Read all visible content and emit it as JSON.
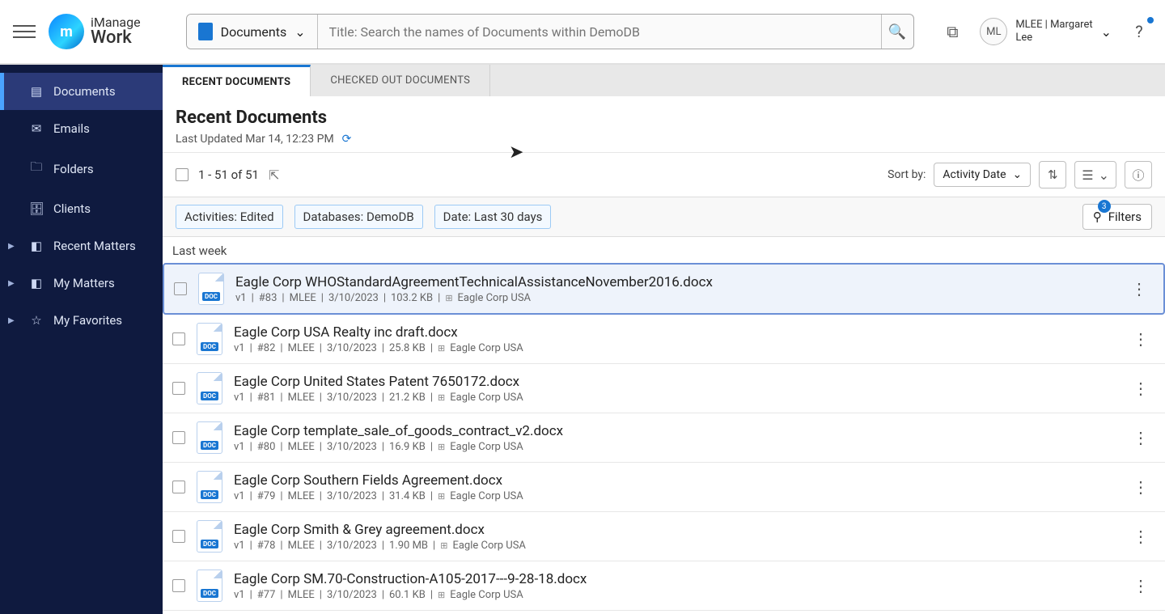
{
  "brand": {
    "l1": "iManage",
    "l2": "Work",
    "mark": "m"
  },
  "search": {
    "scope": "Documents",
    "placeholder": "Title: Search the names of Documents within DemoDB"
  },
  "user": {
    "initials": "ML",
    "line1": "MLEE | Margaret",
    "line2": "Lee"
  },
  "sidebar": [
    {
      "label": "Documents",
      "icon": "▤",
      "active": true,
      "expandable": false
    },
    {
      "label": "Emails",
      "icon": "✉",
      "active": false,
      "expandable": false
    },
    {
      "label": "Folders",
      "icon": "🗀",
      "active": false,
      "expandable": false
    },
    {
      "label": "Clients",
      "icon": "🗄",
      "active": false,
      "expandable": false
    },
    {
      "label": "Recent Matters",
      "icon": "◧",
      "active": false,
      "expandable": true
    },
    {
      "label": "My Matters",
      "icon": "◧",
      "active": false,
      "expandable": true
    },
    {
      "label": "My Favorites",
      "icon": "☆",
      "active": false,
      "expandable": true
    }
  ],
  "tabs": [
    {
      "label": "RECENT DOCUMENTS",
      "active": true
    },
    {
      "label": "CHECKED OUT DOCUMENTS",
      "active": false
    }
  ],
  "page": {
    "title": "Recent Documents",
    "updated": "Last Updated Mar 14, 12:23 PM",
    "count": "1 - 51 of 51"
  },
  "sort": {
    "label": "Sort by:",
    "value": "Activity Date"
  },
  "chips": [
    {
      "text": "Activities: Edited"
    },
    {
      "text": "Databases: DemoDB"
    },
    {
      "text": "Date: Last 30 days"
    }
  ],
  "filters": {
    "label": "Filters",
    "count": "3"
  },
  "group": "Last week",
  "rows": [
    {
      "title": "Eagle Corp WHOStandardAgreementTechnicalAssistanceNovember2016.docx",
      "v": "v1",
      "id": "#83",
      "user": "MLEE",
      "date": "3/10/2023",
      "size": "103.2 KB",
      "org": "Eagle Corp USA",
      "sel": true
    },
    {
      "title": "Eagle Corp USA Realty inc draft.docx",
      "v": "v1",
      "id": "#82",
      "user": "MLEE",
      "date": "3/10/2023",
      "size": "25.8 KB",
      "org": "Eagle Corp USA",
      "sel": false
    },
    {
      "title": "Eagle Corp United States Patent 7650172.docx",
      "v": "v1",
      "id": "#81",
      "user": "MLEE",
      "date": "3/10/2023",
      "size": "21.2 KB",
      "org": "Eagle Corp USA",
      "sel": false
    },
    {
      "title": "Eagle Corp template_sale_of_goods_contract_v2.docx",
      "v": "v1",
      "id": "#80",
      "user": "MLEE",
      "date": "3/10/2023",
      "size": "16.9 KB",
      "org": "Eagle Corp USA",
      "sel": false
    },
    {
      "title": "Eagle Corp Southern Fields Agreement.docx",
      "v": "v1",
      "id": "#79",
      "user": "MLEE",
      "date": "3/10/2023",
      "size": "31.4 KB",
      "org": "Eagle Corp USA",
      "sel": false
    },
    {
      "title": "Eagle Corp Smith & Grey agreement.docx",
      "v": "v1",
      "id": "#78",
      "user": "MLEE",
      "date": "3/10/2023",
      "size": "1.90 MB",
      "org": "Eagle Corp USA",
      "sel": false
    },
    {
      "title": "Eagle Corp SM.70-Construction-A105-2017---9-28-18.docx",
      "v": "v1",
      "id": "#77",
      "user": "MLEE",
      "date": "3/10/2023",
      "size": "60.1 KB",
      "org": "Eagle Corp USA",
      "sel": false
    }
  ]
}
